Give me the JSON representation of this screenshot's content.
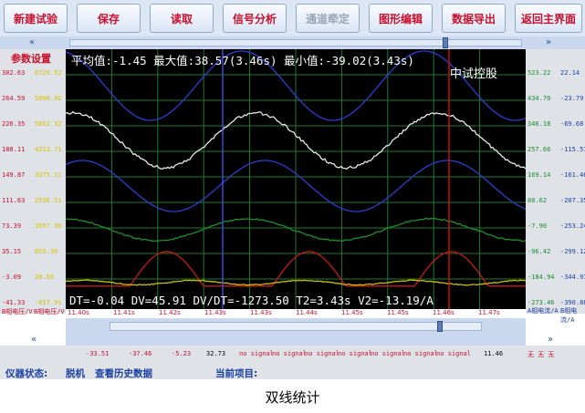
{
  "toolbar": {
    "buttons": [
      {
        "label": "新建试验",
        "disabled": false
      },
      {
        "label": "保存",
        "disabled": false
      },
      {
        "label": "读取",
        "disabled": false
      },
      {
        "label": "信号分析",
        "disabled": false
      },
      {
        "label": "通道牵定",
        "disabled": true
      },
      {
        "label": "图形编辑",
        "disabled": false
      },
      {
        "label": "数据导出",
        "disabled": false
      },
      {
        "label": "返回主界面",
        "disabled": false
      }
    ]
  },
  "nav": {
    "left_chevron": "«",
    "right_chevron": "»"
  },
  "left_panel": {
    "settings_label": "参数设置",
    "scale_a": [
      "302.63",
      "264.59",
      "226.35",
      "188.11",
      "149.87",
      "111.63",
      "73.39",
      "35.15",
      "-3.09",
      "-41.33"
    ],
    "scale_b": [
      "6729.52",
      "5890.92",
      "5052.32",
      "4213.71",
      "3375.11",
      "2536.51",
      "1697.90",
      "859.30",
      "20.69",
      "-817.91"
    ],
    "axis_label_a": "B相电压/V",
    "axis_label_b": "B相电压/V"
  },
  "right_panel": {
    "scale_a": [
      "523.22",
      "434.70",
      "346.18",
      "257.66",
      "169.14",
      "80.62",
      "-7.90",
      "-96.42",
      "-184.94",
      "-273.46"
    ],
    "scale_b": [
      "22.14",
      "-23.79",
      "-69.68",
      "-115.57",
      "-161.46",
      "-207.35",
      "-253.24",
      "-299.12",
      "-344.97",
      "-390.88"
    ],
    "axis_label_a": "A相电流/A",
    "axis_label_b": "B相电流/A"
  },
  "plot": {
    "stats": "平均值:-1.45 最大值:38.57(3.46s) 最小值:-39.02(3.43s)",
    "watermark": "中试控股",
    "cursor_readout": "DT=-0.04 DV=45.91 DV/DT=-1273.50 T2=3.43s V2=-13.19/A",
    "time_ticks": [
      "11.40s",
      "11.41s",
      "11.42s",
      "11.43s",
      "11.43s",
      "11.44s",
      "11.45s",
      "11.45s",
      "11.46s",
      "11.47s"
    ],
    "colors": {
      "background": "#000000",
      "grid": "#1f7a2e",
      "white": "#e8e8e8",
      "blue": "#2a3fd0",
      "green": "#1f8f2a",
      "red": "#c81818",
      "yellow": "#c8c000",
      "cursor_blue": "#3a55ff",
      "cursor_red": "#e01010"
    }
  },
  "readings": [
    {
      "text": "-33.51",
      "color": "#c8102e"
    },
    {
      "text": "-37.46",
      "color": "#c8102e"
    },
    {
      "text": "-5.23",
      "color": "#c8102e"
    },
    {
      "text": "32.73",
      "color": "#000000"
    },
    {
      "text": "no signal",
      "color": "#c8102e"
    },
    {
      "text": "no signal",
      "color": "#c8102e"
    },
    {
      "text": "no signal",
      "color": "#c8102e"
    },
    {
      "text": "no signal",
      "color": "#c8102e"
    },
    {
      "text": "no signal",
      "color": "#c8102e"
    },
    {
      "text": "no signal",
      "color": "#c8102e"
    },
    {
      "text": "no signal",
      "color": "#c8102e"
    },
    {
      "text": "11.46",
      "color": "#000000"
    },
    {
      "text": "无 无 无",
      "color": "#c8102e"
    }
  ],
  "status": {
    "device_label": "仪器状态:",
    "device_value": "脱机",
    "history": "查看历史数据",
    "project_label": "当前项目:"
  },
  "caption": "双线统计"
}
